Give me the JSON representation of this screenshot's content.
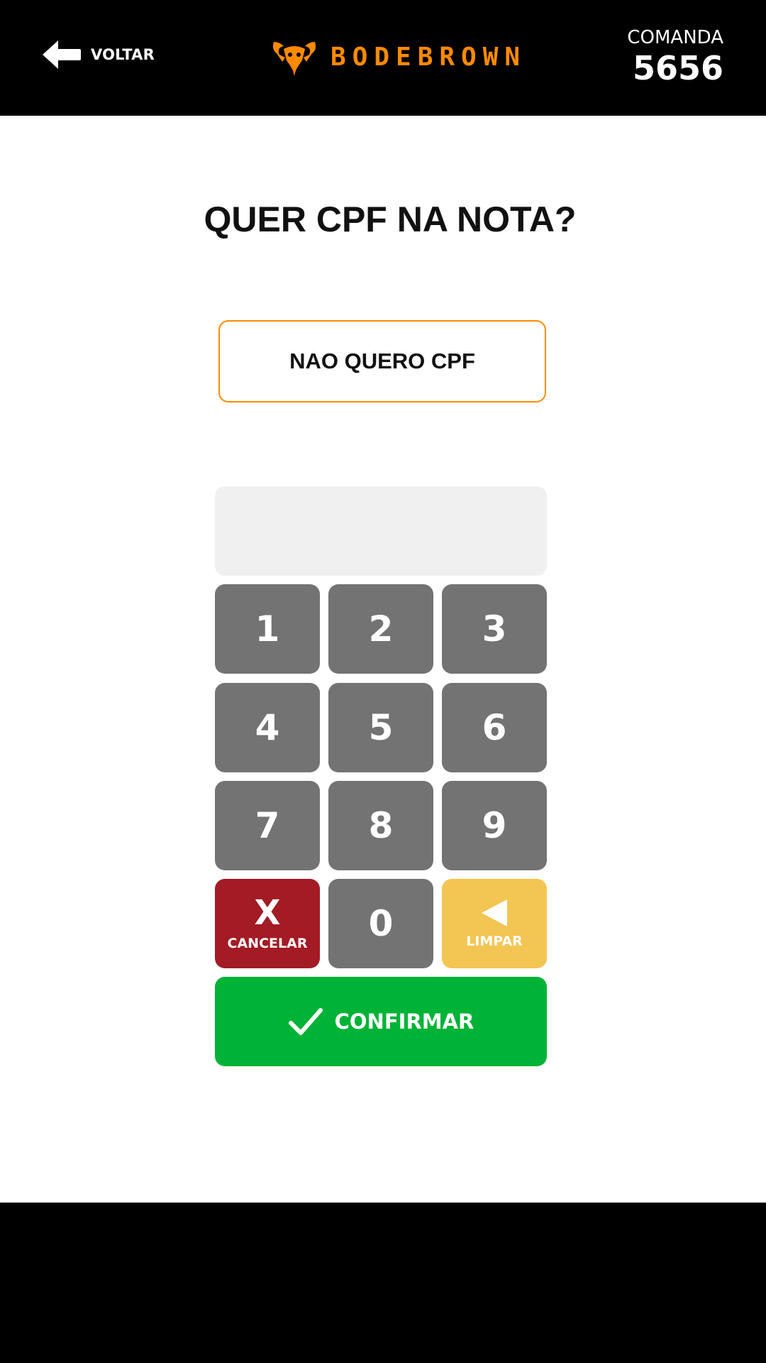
{
  "header": {
    "back_label": "VOLTAR",
    "brand_name": "BODEBROWN",
    "comanda_label": "COMANDA",
    "comanda_number": "5656"
  },
  "main": {
    "title": "QUER CPF NA NOTA?",
    "no_cpf_label": "NAO QUERO CPF",
    "cpf_value": ""
  },
  "keypad": {
    "keys": [
      "1",
      "2",
      "3",
      "4",
      "5",
      "6",
      "7",
      "8",
      "9",
      "0"
    ],
    "cancel_symbol": "X",
    "cancel_label": "CANCELAR",
    "clear_label": "LIMPAR",
    "confirm_label": "CONFIRMAR"
  },
  "colors": {
    "accent": "#ff8a00",
    "key": "#737373",
    "cancel": "#a31b24",
    "clear": "#f3c552",
    "confirm": "#00b336"
  },
  "icons": {
    "back": "arrow-left-icon",
    "logo": "goat-logo-icon",
    "clear": "triangle-left-icon",
    "confirm": "checkmark-icon"
  }
}
